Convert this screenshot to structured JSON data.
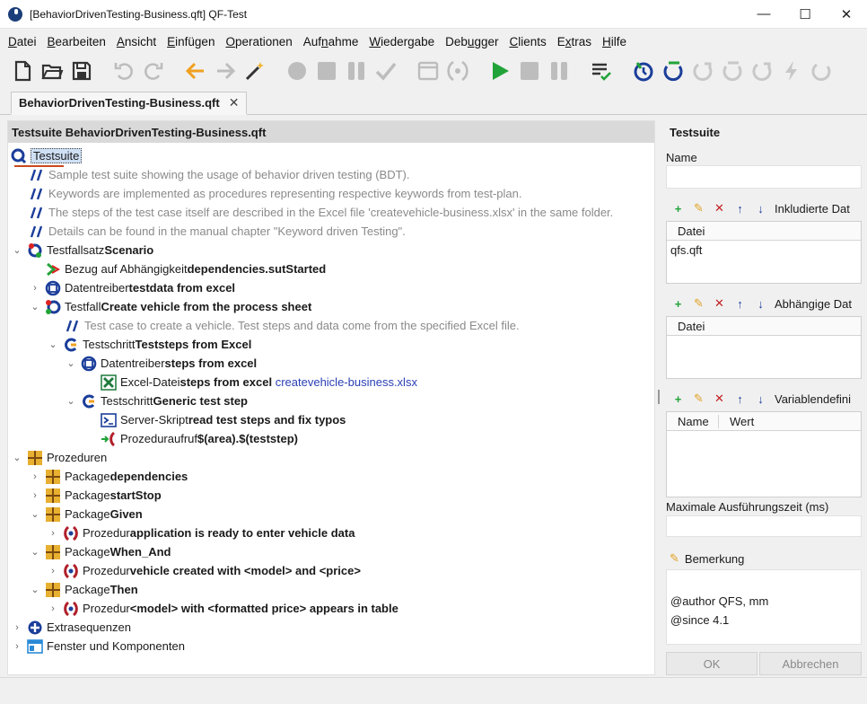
{
  "window": {
    "title": "[BehaviorDrivenTesting-Business.qft] QF-Test",
    "minimize": "—",
    "maximize": "☐",
    "close": "✕"
  },
  "menu": [
    {
      "u": "D",
      "rest": "atei"
    },
    {
      "u": "B",
      "rest": "earbeiten"
    },
    {
      "u": "A",
      "rest": "nsicht"
    },
    {
      "u": "E",
      "rest": "infügen"
    },
    {
      "u": "O",
      "rest": "perationen"
    },
    {
      "pre": "Auf",
      "u": "n",
      "rest": "ahme"
    },
    {
      "u": "W",
      "rest": "iedergabe"
    },
    {
      "pre": "Deb",
      "u": "u",
      "rest": "gger"
    },
    {
      "u": "C",
      "rest": "lients"
    },
    {
      "pre": "E",
      "u": "x",
      "rest": "tras"
    },
    {
      "u": "H",
      "rest": "ilfe"
    }
  ],
  "tab": {
    "label": "BehaviorDrivenTesting-Business.qft",
    "close": "✕"
  },
  "tree": {
    "header": "Testsuite BehaviorDrivenTesting-Business.qft",
    "rows": [
      {
        "t": "Testsuite"
      },
      {
        "t": "Sample test suite showing the usage of behavior driven testing (BDT)."
      },
      {
        "t": "Keywords are implemented as procedures representing respective keywords from test-plan."
      },
      {
        "t": "The steps of the test case itself are described in the Excel file 'createvehicle-business.xlsx' in the same folder."
      },
      {
        "t": "Details can be found in the manual chapter \"Keyword driven Testing\"."
      },
      {
        "p": "Testfallsatz ",
        "b": "Scenario"
      },
      {
        "p": "Bezug auf Abhängigkeit ",
        "b": "dependencies.sutStarted"
      },
      {
        "p": "Datentreiber ",
        "b": "testdata from excel"
      },
      {
        "p": "Testfall ",
        "b": "Create vehicle from the process sheet"
      },
      {
        "t": "Test case to create a vehicle. Test steps and data come from the specified Excel file."
      },
      {
        "p": "Testschritt ",
        "b": "Teststeps from Excel"
      },
      {
        "p": "Datentreiber ",
        "b": "steps from excel"
      },
      {
        "p": "Excel-Datei ",
        "b": "steps from excel",
        "l": "createvehicle-business.xlsx"
      },
      {
        "p": "Testschritt ",
        "b": "Generic test step"
      },
      {
        "p": "Server-Skript ",
        "b": "read test steps and fix typos"
      },
      {
        "p": "Prozeduraufruf ",
        "b": "$(area).$(teststep)"
      },
      {
        "p": "Prozeduren"
      },
      {
        "p": "Package ",
        "b": "dependencies"
      },
      {
        "p": "Package ",
        "b": "startStop"
      },
      {
        "p": "Package ",
        "b": "Given"
      },
      {
        "p": "Prozedur ",
        "b": "application is ready to enter vehicle data"
      },
      {
        "p": "Package ",
        "b": "When_And"
      },
      {
        "p": "Prozedur ",
        "b": "vehicle created with <model> and <price>"
      },
      {
        "p": "Package ",
        "b": "Then"
      },
      {
        "p": "Prozedur ",
        "b": "<model> with <formatted price> appears in table"
      },
      {
        "p": "Extrasequenzen"
      },
      {
        "p": "Fenster und Komponenten"
      }
    ]
  },
  "details": {
    "title": "Testsuite",
    "name_label": "Name",
    "name_value": "",
    "included_label": "Inkludierte Dat",
    "included_header": "Datei",
    "included_rows": [
      "qfs.qft"
    ],
    "dependent_label": "Abhängige Dat",
    "dependent_header": "Datei",
    "vars_label": "Variablendefini",
    "vars_headers": [
      "Name",
      "Wert"
    ],
    "maxtime_label": "Maximale Ausführungszeit (ms)",
    "maxtime_value": "",
    "remark_label": "Bemerkung",
    "remark_lines": [
      "@author QFS, mm",
      "@since 4.1"
    ],
    "ok": "OK",
    "cancel": "Abbrechen"
  },
  "colors": {
    "accent": "#2a3fb4",
    "run_green": "#22a339",
    "arrow_orange": "#f0a020"
  }
}
